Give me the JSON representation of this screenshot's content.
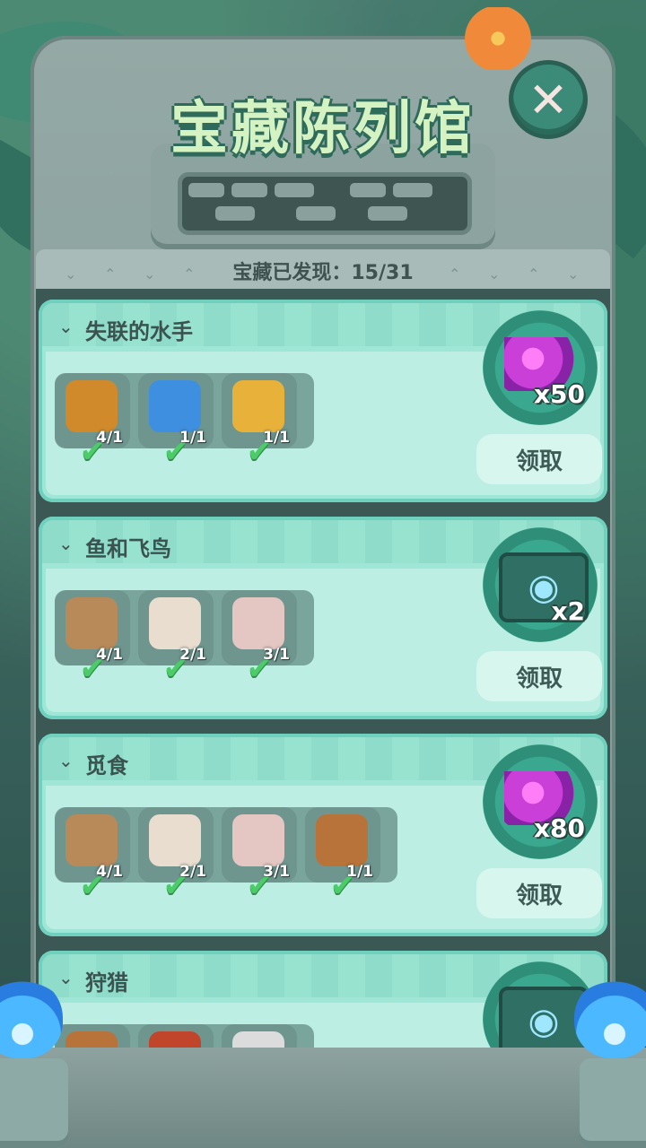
{
  "title": "宝藏陈列馆",
  "close_symbol": "✕",
  "found_label": "宝藏已发现：15/31",
  "chevron_down": "⌄",
  "chevron_up": "⌃",
  "check_symbol": "✔",
  "collections": [
    {
      "name": "失联的水手",
      "reward_type": "gems",
      "reward_amount": "x50",
      "claim_label": "领取",
      "items": [
        {
          "icon": "spyglass-icon",
          "count": "4/1",
          "color": "#d08a2c"
        },
        {
          "icon": "compass-icon",
          "count": "1/1",
          "color": "#3f8fe0"
        },
        {
          "icon": "magnifier-icon",
          "count": "1/1",
          "color": "#e8b23a"
        }
      ]
    },
    {
      "name": "鱼和飞鸟",
      "reward_type": "eye-ticket",
      "reward_amount": "x2",
      "claim_label": "领取",
      "items": [
        {
          "icon": "fish-fossil-icon",
          "count": "4/1",
          "color": "#b88a5a"
        },
        {
          "icon": "tooth-necklace-icon",
          "count": "2/1",
          "color": "#e9ddd0"
        },
        {
          "icon": "bird-skull-icon",
          "count": "3/1",
          "color": "#e4c6c2"
        }
      ]
    },
    {
      "name": "觅食",
      "reward_type": "gems",
      "reward_amount": "x80",
      "claim_label": "领取",
      "items": [
        {
          "icon": "fish-fossil-icon",
          "count": "4/1",
          "color": "#b88a5a"
        },
        {
          "icon": "tooth-necklace-icon",
          "count": "2/1",
          "color": "#e9ddd0"
        },
        {
          "icon": "bird-skull-icon",
          "count": "3/1",
          "color": "#e4c6c2"
        },
        {
          "icon": "slingshot-icon",
          "count": "1/1",
          "color": "#b8733a"
        }
      ]
    },
    {
      "name": "狩猎",
      "reward_type": "eye-ticket",
      "reward_amount": "",
      "claim_label": "",
      "items": [
        {
          "icon": "pot-icon",
          "count": "",
          "color": "#b8733a"
        },
        {
          "icon": "meat-icon",
          "count": "",
          "color": "#c0452a"
        },
        {
          "icon": "arrowhead-icon",
          "count": "",
          "color": "#dcdcdc"
        }
      ]
    }
  ]
}
